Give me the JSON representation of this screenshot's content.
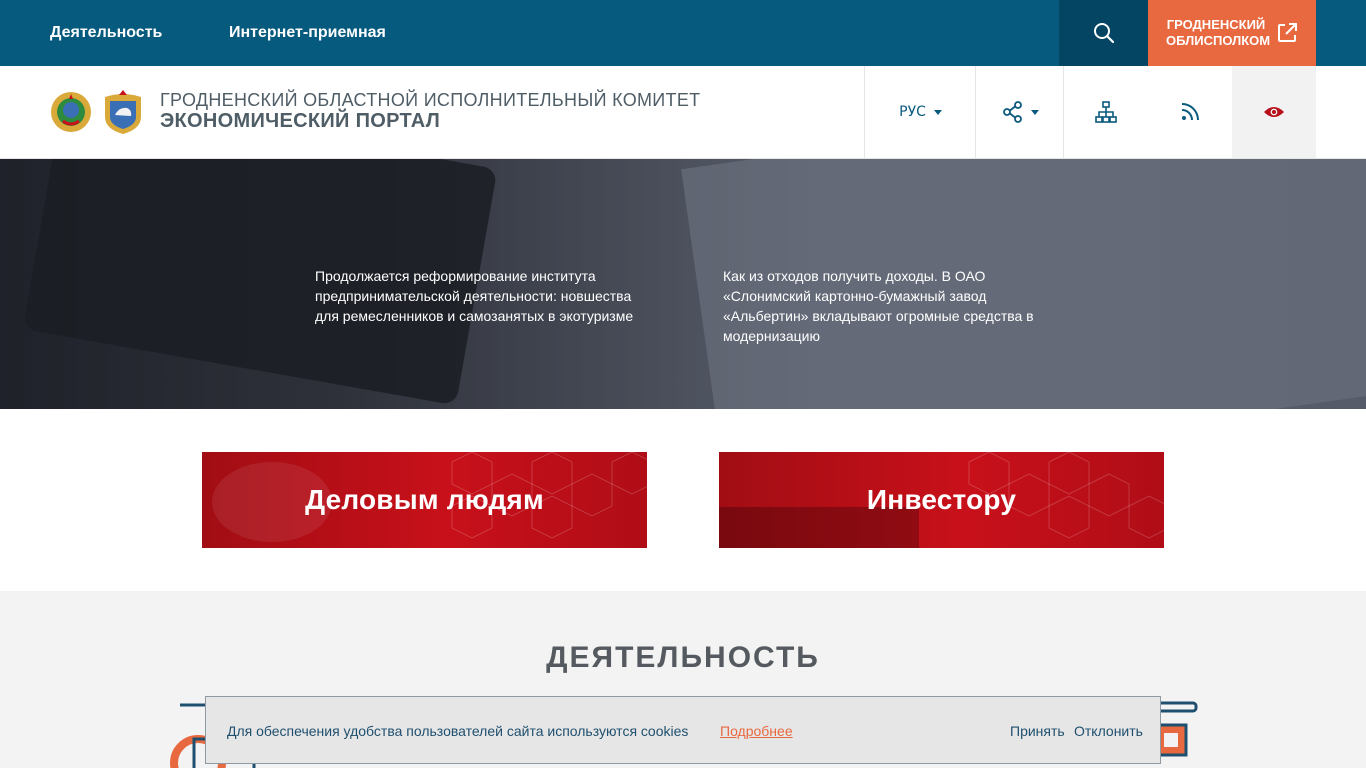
{
  "topbar": {
    "nav": [
      {
        "label": "Деятельность"
      },
      {
        "label": "Интернет-приемная"
      }
    ],
    "search_icon": "search-icon",
    "oblis_line1": "ГРОДНЕНСКИЙ",
    "oblis_line2": "ОБЛИСПОЛКОМ",
    "external_icon": "external-link-icon"
  },
  "header": {
    "subtitle": "ГРОДНЕНСКИЙ ОБЛАСТНОЙ ИСПОЛНИТЕЛЬНЫЙ КОМИТЕТ",
    "title": "ЭКОНОМИЧЕСКИЙ ПОРТАЛ",
    "language": "РУС",
    "icons": [
      "share-icon",
      "sitemap-icon",
      "rss-icon",
      "eye-icon"
    ]
  },
  "hero": {
    "news": [
      {
        "text": "Продолжается реформирование института предпринимательской деятельности: новшества для ремесленников и самозанятых в экотуризме"
      },
      {
        "text": "Как из отходов получить доходы. В ОАО «Слонимский картонно-бумажный завод «Альбертин» вкладывают огромные средства в модернизацию"
      }
    ]
  },
  "banners": [
    {
      "label": "Деловым людям"
    },
    {
      "label": "Инвестору"
    }
  ],
  "activity": {
    "title": "ДЕЯТЕЛЬНОСТЬ"
  },
  "cookie": {
    "text": "Для обеспечения удобства пользователей сайта используются cookies",
    "more": "Подробнее",
    "accept": "Принять",
    "decline": "Отклонить"
  },
  "colors": {
    "topbar": "#055a7d",
    "accent_orange": "#e8683f",
    "banner_red": "#c8101a"
  }
}
